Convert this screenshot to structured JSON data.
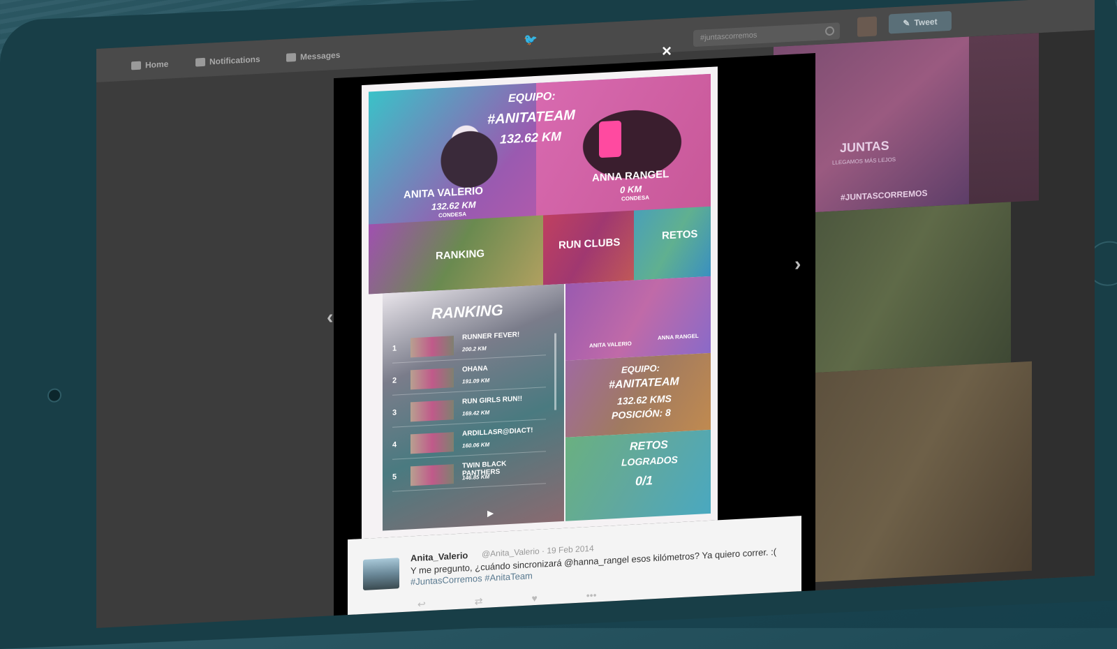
{
  "nav": {
    "home": "Home",
    "notifications": "Notifications",
    "messages": "Messages",
    "search_placeholder": "#juntascorremos",
    "tweet_button": "Tweet"
  },
  "modal": {
    "close": "×",
    "prev": "‹",
    "next": "›"
  },
  "card": {
    "hero": {
      "equipo": "EQUIPO:",
      "team": "#ANITATEAM",
      "team_km": "132.62 KM",
      "player1": {
        "name": "ANITA VALERIO",
        "km": "132.62 KM",
        "city": "CONDESA"
      },
      "player2": {
        "name": "ANNA RANGEL",
        "km": "0 KM",
        "city": "CONDESA"
      }
    },
    "tiles": {
      "ranking": "RANKING",
      "run_clubs": "RUN CLUBS",
      "retos": "RETOS"
    },
    "ranking": {
      "title": "RANKING",
      "rows": [
        {
          "pos": "1",
          "name": "RUNNER FEVER!",
          "km": "200.2 KM"
        },
        {
          "pos": "2",
          "name": "OHANA",
          "km": "191.09 KM"
        },
        {
          "pos": "3",
          "name": "RUN GIRLS RUN!!",
          "km": "169.42 KM"
        },
        {
          "pos": "4",
          "name": "ARDILLASR@DIACT!",
          "km": "160.06 KM"
        },
        {
          "pos": "5",
          "name": "TWIN BLACK PANTHERS",
          "km": "146.85 KM"
        }
      ]
    },
    "mini": {
      "left": "ANITA VALERIO",
      "right": "ANNA RANGEL"
    },
    "stat": {
      "equipo": "EQUIPO:",
      "team": "#ANITATEAM",
      "kms": "132.62 KMS",
      "posicion": "POSICIÓN: 8"
    },
    "retos": {
      "title": "RETOS",
      "sub": "LOGRADOS",
      "value": "0/1"
    }
  },
  "gallery": {
    "big": "JUNTAS",
    "small": "LLEGAMOS MÁS LEJOS",
    "tag": "#JUNTASCORREMOS"
  },
  "tweet": {
    "name": "Anita_Valerio",
    "handle": "@Anita_Valerio · 19 Feb 2014",
    "text_pre": "Y me pregunto, ¿cuándo sincronizará @hanna_rangel esos kilómetros? Ya quiero correr. :( ",
    "hashtag1": "#JuntasCorremos",
    "hashtag2": "#AnitaTeam",
    "actions": {
      "reply": "↩",
      "retweet": "⇄",
      "favorite": "♥",
      "more": "•••"
    }
  }
}
